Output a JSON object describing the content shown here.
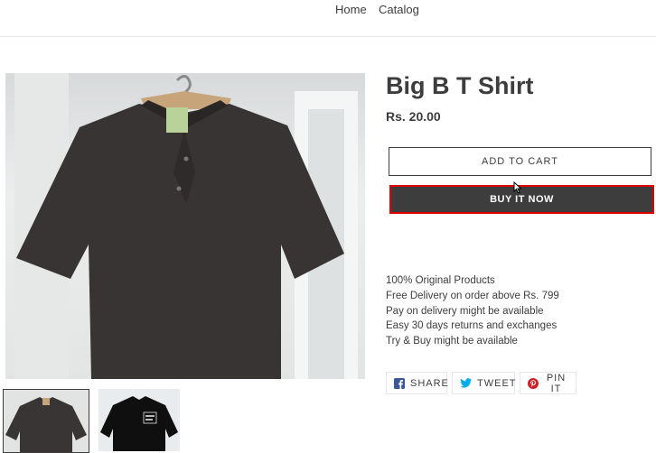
{
  "nav": {
    "items": [
      {
        "label": "Home"
      },
      {
        "label": "Catalog"
      }
    ]
  },
  "product": {
    "title": "Big B T Shirt",
    "price": "Rs. 20.00",
    "add_to_cart_label": "ADD TO CART",
    "buy_now_label": "BUY IT NOW",
    "features": [
      "100% Original Products",
      "Free Delivery on order above Rs. 799",
      "Pay on delivery might be available",
      "Easy 30 days returns and exchanges",
      "Try & Buy might be available"
    ]
  },
  "share": {
    "facebook_label": "SHARE",
    "twitter_label": "TWEET",
    "pinterest_label": "PIN IT"
  },
  "colors": {
    "text": "#3d3d3d",
    "button_dark": "#3d3d3d",
    "highlight_border": "#e00000",
    "facebook": "#3b5998",
    "twitter": "#00aced",
    "pinterest": "#cb2027"
  },
  "icons": [
    "facebook-icon",
    "twitter-icon",
    "pinterest-icon",
    "cursor-icon"
  ]
}
